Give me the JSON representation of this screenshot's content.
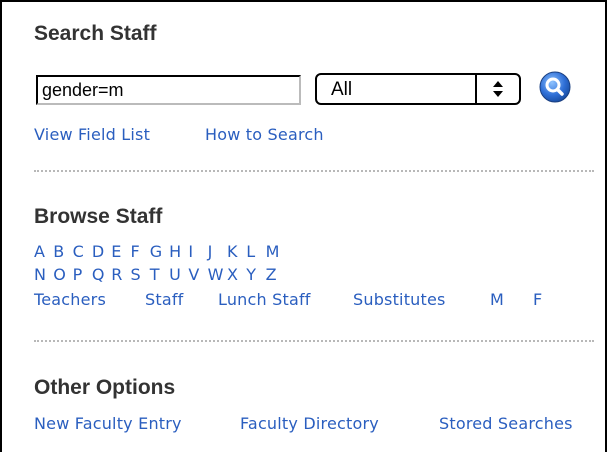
{
  "search": {
    "title": "Search Staff",
    "query": "gender=m",
    "scope": "All",
    "links": [
      "View Field List",
      "How to Search"
    ]
  },
  "browse": {
    "title": "Browse Staff",
    "letters_row1": [
      "A",
      "B",
      "C",
      "D",
      "E",
      "F",
      "G",
      "H",
      "I",
      "J",
      "K",
      "L",
      "M"
    ],
    "letters_row2": [
      "N",
      "O",
      "P",
      "Q",
      "R",
      "S",
      "T",
      "U",
      "V",
      "W",
      "X",
      "Y",
      "Z"
    ],
    "categories": [
      "Teachers",
      "Staff",
      "Lunch Staff",
      "Substitutes",
      "M",
      "F"
    ]
  },
  "other": {
    "title": "Other Options",
    "links": [
      "New Faculty Entry",
      "Faculty Directory",
      "Stored Searches"
    ]
  },
  "colors": {
    "link": "#2a5ebf",
    "heading": "#333333",
    "search_button": "#2f6fd6"
  },
  "icons": [
    "search-icon",
    "select-arrows-icon"
  ]
}
